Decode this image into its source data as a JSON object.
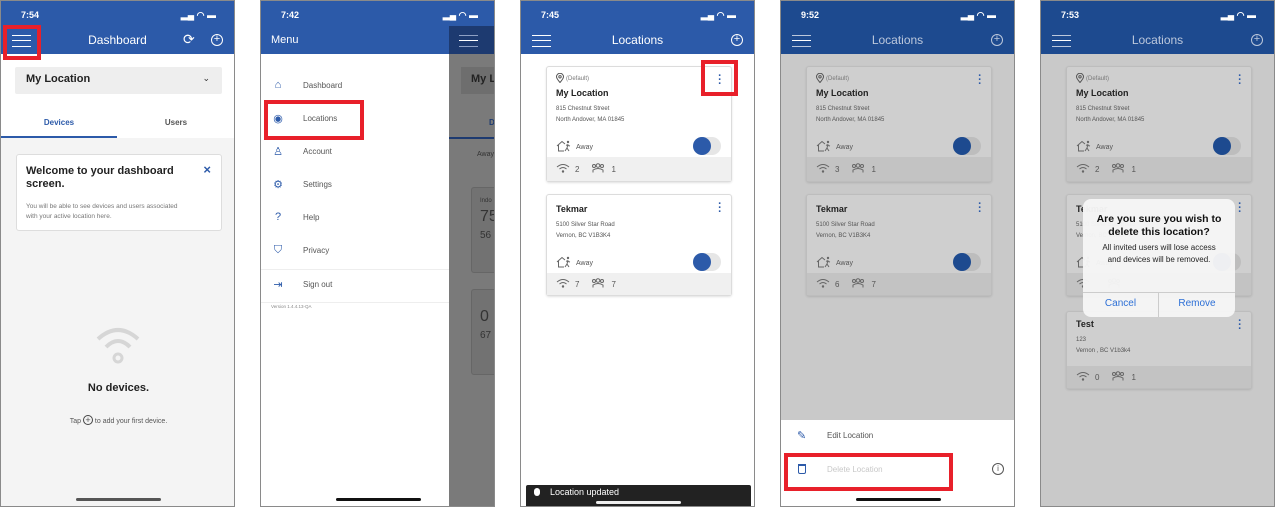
{
  "colors": {
    "primary": "#2c5aa9",
    "primary_dim": "#1d4a8f",
    "highlight": "#e8202a",
    "overlay": "#c9c9c9"
  },
  "screens": [
    {
      "status_time": "7:54",
      "nav_title": "Dashboard",
      "nav_icons": [
        "menu-icon",
        "refresh-icon",
        "add-circle-icon"
      ],
      "location_select": "My Location",
      "tabs": [
        {
          "label": "Devices",
          "active": true
        },
        {
          "label": "Users",
          "active": false
        }
      ],
      "welcome": {
        "title": "Welcome to your dashboard screen.",
        "body": "You will be able to see devices and users associated with your active location here.",
        "close": "×"
      },
      "empty": {
        "title": "No devices.",
        "hint_before": "Tap",
        "hint_after": "to add your first device."
      }
    },
    {
      "status_time": "7:42",
      "nav_title": "Menu",
      "menu": [
        {
          "label": "Dashboard",
          "icon": "home-icon"
        },
        {
          "label": "Locations",
          "icon": "location-pin-icon"
        },
        {
          "label": "Account",
          "icon": "account-icon"
        },
        {
          "label": "Settings",
          "icon": "gear-icon"
        },
        {
          "label": "Help",
          "icon": "help-icon"
        },
        {
          "label": "Privacy",
          "icon": "shield-icon"
        },
        {
          "label": "Sign out",
          "icon": "sign-out-icon"
        }
      ],
      "version": "Version 1.4.4.13-QA",
      "background_fragments": {
        "location": "My L",
        "tab": "D",
        "mode": "Away",
        "tile": "Indo",
        "temp1": "75",
        "temp2": "56",
        "temp3": "0",
        "temp4": "67"
      }
    },
    {
      "status_time": "7:45",
      "nav_title": "Locations",
      "cards": [
        {
          "default_label": "(Default)",
          "name": "My Location",
          "address_line1": "815 Chestnut Street",
          "address_line2": "North Andover, MA 01845",
          "mode": "Away",
          "away_on": true,
          "devices": "2",
          "users": "1"
        },
        {
          "default_label": "",
          "name": "Tekmar",
          "address_line1": "5100 Silver Star Road",
          "address_line2": "Vernon, BC V1B3K4",
          "mode": "Away",
          "away_on": true,
          "devices": "7",
          "users": "7"
        }
      ],
      "snackbar": "Location updated"
    },
    {
      "status_time": "9:52",
      "nav_title": "Locations",
      "cards": [
        {
          "default_label": "(Default)",
          "name": "My Location",
          "address_line1": "815 Chestnut Street",
          "address_line2": "North Andover, MA 01845",
          "mode": "Away",
          "away_on": true,
          "devices": "3",
          "users": "1"
        },
        {
          "default_label": "",
          "name": "Tekmar",
          "address_line1": "5100 Silver Star Road",
          "address_line2": "Vernon, BC V1B3K4",
          "mode": "Away",
          "away_on": true,
          "devices": "6",
          "users": "7"
        }
      ],
      "sheet": {
        "edit": "Edit Location",
        "delete": "Delete Location"
      }
    },
    {
      "status_time": "7:53",
      "nav_title": "Locations",
      "cards": [
        {
          "default_label": "(Default)",
          "name": "My Location",
          "address_line1": "815 Chestnut Street",
          "address_line2": "North Andover, MA 01845",
          "mode": "Away",
          "away_on": true,
          "devices": "2",
          "users": "1"
        },
        {
          "default_label": "",
          "name": "Tekmar",
          "address_line1": "5100 Silver Star Road",
          "address_line2": "Vernon, BC V1B3K4",
          "mode": "Away",
          "away_on": true,
          "devices": "",
          "users": ""
        },
        {
          "default_label": "",
          "name": "Test",
          "address_line1": "123",
          "address_line2": "Vernon , BC V1b3k4",
          "mode": "",
          "away_on": false,
          "devices": "0",
          "users": "1"
        }
      ],
      "dialog": {
        "title": "Are you sure you wish to delete this location?",
        "message": "All invited users will lose access and devices will be removed.",
        "cancel": "Cancel",
        "confirm": "Remove"
      }
    }
  ]
}
